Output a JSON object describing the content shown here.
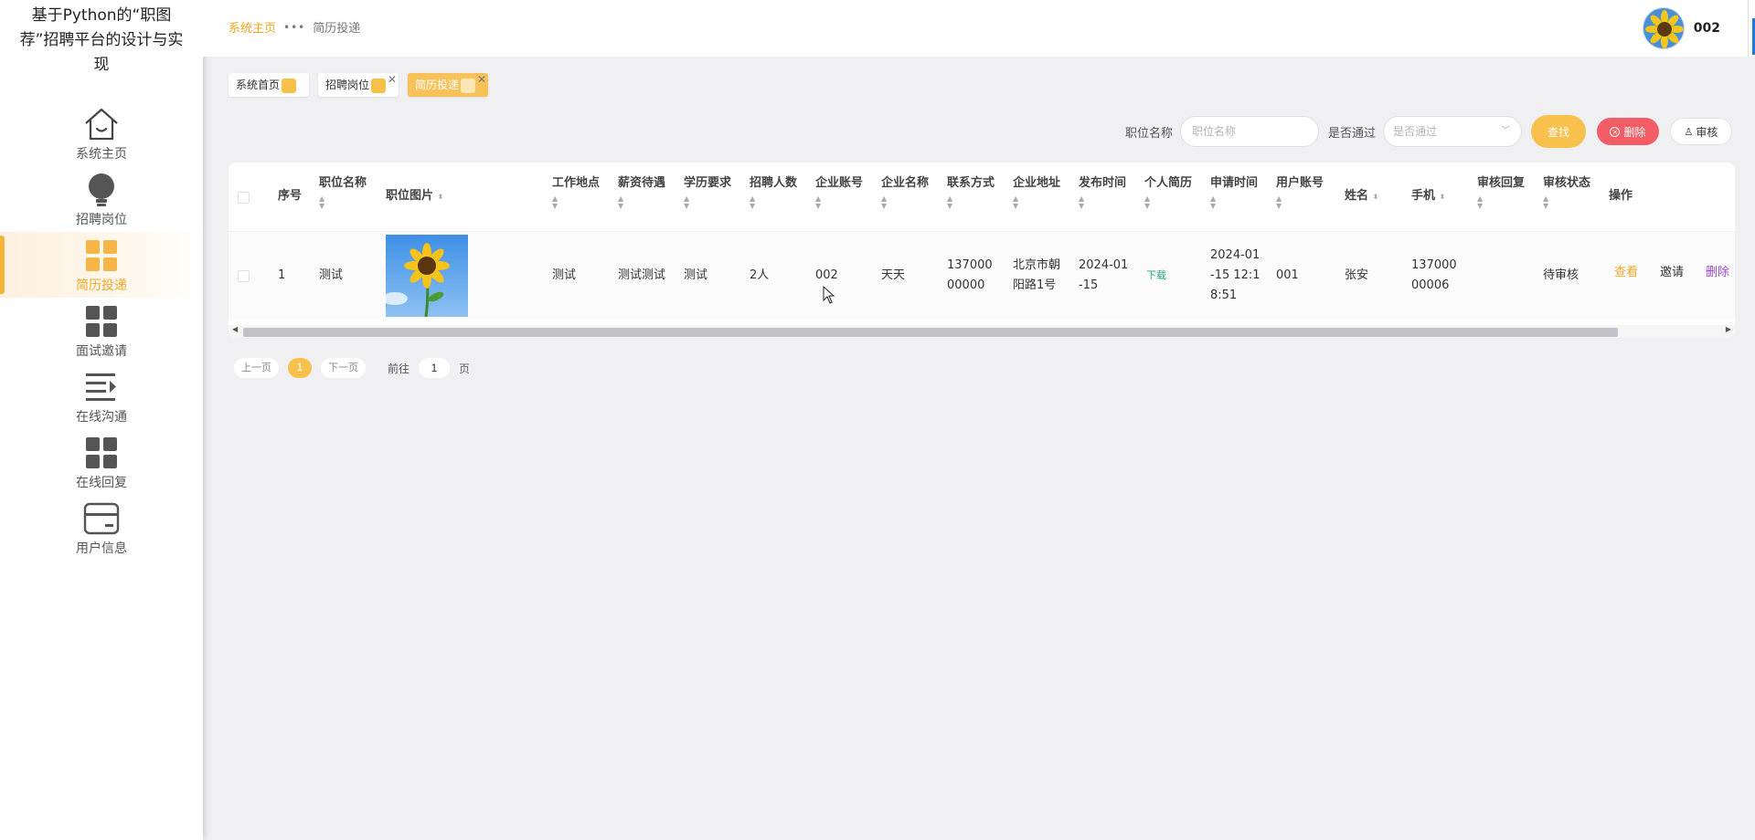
{
  "app": {
    "title": "基于Python的“职图荐”招聘平台的设计与实现"
  },
  "sidebar": {
    "items": [
      {
        "label": "系统主页",
        "icon": "house-icon",
        "active": false
      },
      {
        "label": "招聘岗位",
        "icon": "lightbulb-icon",
        "active": false
      },
      {
        "label": "简历投递",
        "icon": "grid-icon",
        "active": true
      },
      {
        "label": "面试邀请",
        "icon": "grid-icon",
        "active": false
      },
      {
        "label": "在线沟通",
        "icon": "list-icon",
        "active": false
      },
      {
        "label": "在线回复",
        "icon": "grid-icon",
        "active": false
      },
      {
        "label": "用户信息",
        "icon": "card-icon",
        "active": false
      }
    ]
  },
  "header": {
    "breadcrumb": {
      "home": "系统主页",
      "separator": "•••",
      "current": "简历投递"
    },
    "user": {
      "name": "002"
    }
  },
  "tabs": [
    {
      "label": "系统首页",
      "closable": false,
      "active": false
    },
    {
      "label": "招聘岗位",
      "closable": true,
      "active": false
    },
    {
      "label": "简历投递",
      "closable": true,
      "active": true
    }
  ],
  "search": {
    "position_label": "职位名称",
    "position_placeholder": "职位名称",
    "pass_label": "是否通过",
    "pass_placeholder": "是否通过",
    "find_label": "查找",
    "delete_label": "删除",
    "audit_label": "审核"
  },
  "table": {
    "columns": [
      "序号",
      "职位名称",
      "职位图片",
      "工作地点",
      "薪资待遇",
      "学历要求",
      "招聘人数",
      "企业账号",
      "企业名称",
      "联系方式",
      "企业地址",
      "发布时间",
      "个人简历",
      "申请时间",
      "用户账号",
      "姓名",
      "手机",
      "审核回复",
      "审核状态",
      "操作"
    ],
    "rows": [
      {
        "index": "1",
        "position": "测试",
        "location": "测试",
        "salary": "测试测试",
        "education": "测试",
        "headcount": "2人",
        "company_account": "002",
        "company_name": "天天",
        "contact": "13700000000",
        "address": "北京市朝阳路1号",
        "publish_time": "2024-01-15",
        "resume": "下载",
        "apply_time": "2024-01-15 12:18:51",
        "user_account": "001",
        "name": "张安",
        "phone": "13700000006",
        "reply": "",
        "status": "待审核",
        "actions": {
          "view": "查看",
          "invite": "邀请",
          "delete": "删除"
        }
      }
    ]
  },
  "pagination": {
    "prev": "上一页",
    "current": "1",
    "next": "下一页",
    "goto": "前往",
    "goto_value": "1",
    "page_unit": "页"
  },
  "colors": {
    "accent": "#f5a623",
    "danger": "#f25d66",
    "link_green": "#2aa67a",
    "purple": "#9a4ad8"
  }
}
